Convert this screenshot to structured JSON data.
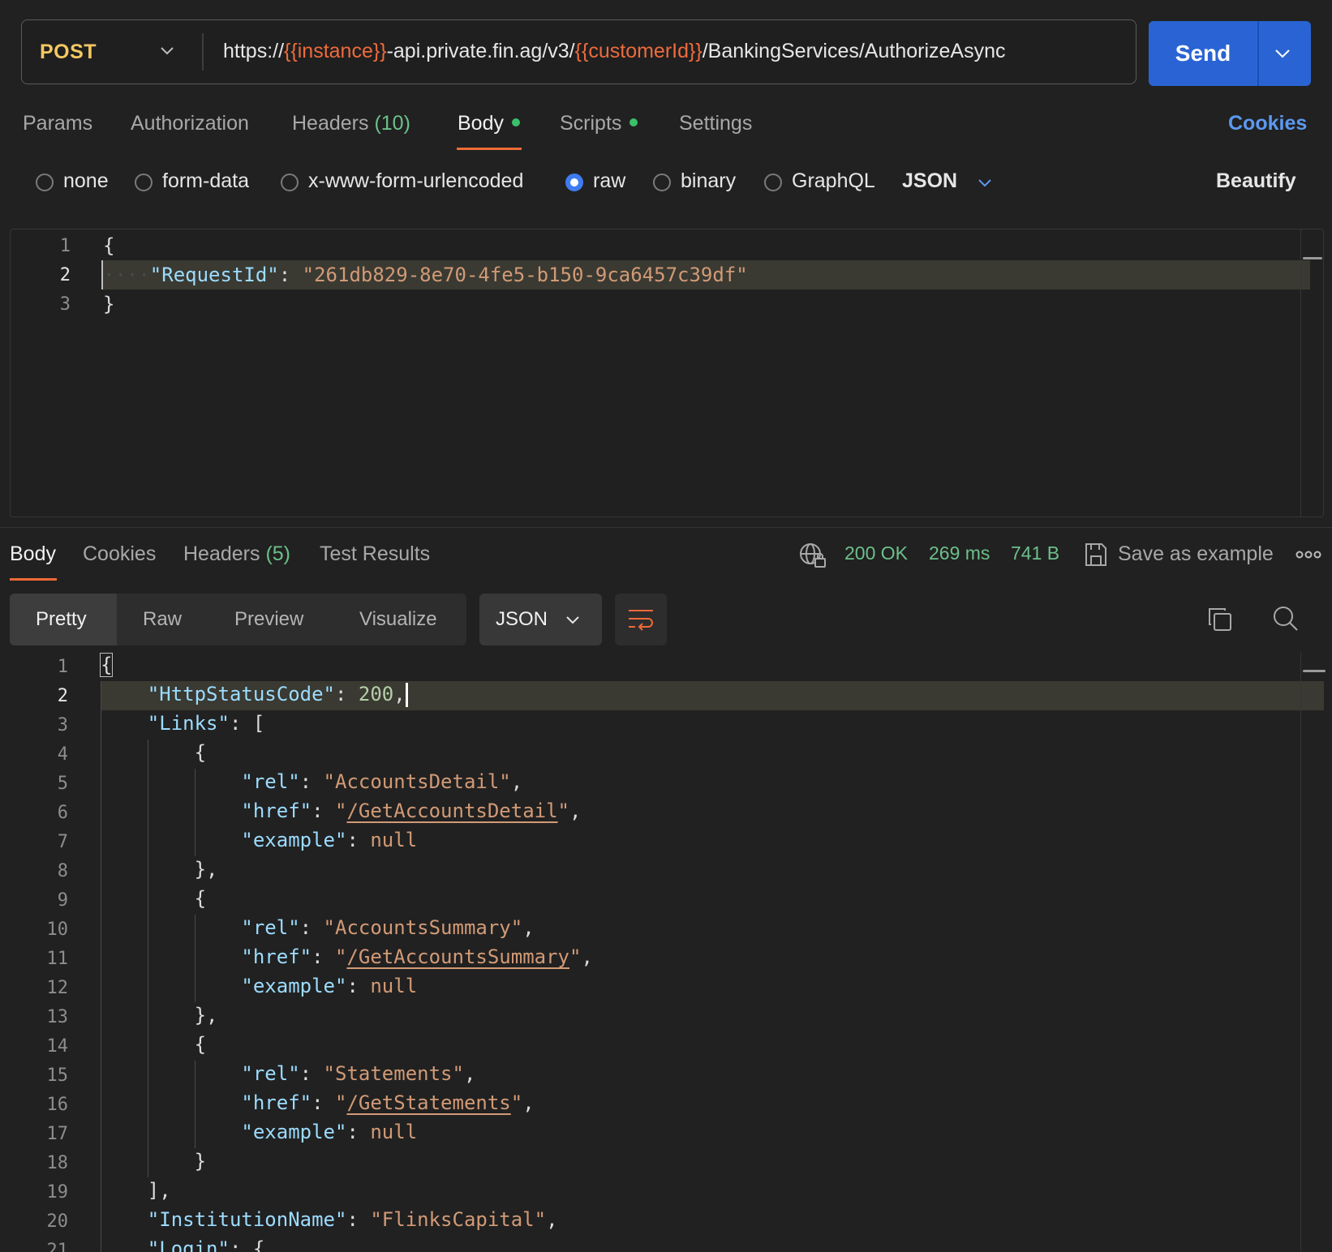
{
  "request": {
    "method": "POST",
    "url_parts": [
      {
        "text": "https://",
        "var": false
      },
      {
        "text": "{{instance}}",
        "var": true
      },
      {
        "text": "-api.private.fin.ag/v3/",
        "var": false
      },
      {
        "text": "{{customerId}}",
        "var": true
      },
      {
        "text": "/BankingServices/AuthorizeAsync",
        "var": false
      }
    ],
    "send_label": "Send"
  },
  "request_tabs": {
    "params": "Params",
    "authorization": "Authorization",
    "headers": "Headers",
    "headers_count": "(10)",
    "body": "Body",
    "scripts": "Scripts",
    "settings": "Settings",
    "cookies": "Cookies"
  },
  "body_types": {
    "none": "none",
    "form_data": "form-data",
    "urlencoded": "x-www-form-urlencoded",
    "raw": "raw",
    "binary": "binary",
    "graphql": "GraphQL",
    "format": "JSON",
    "beautify": "Beautify",
    "selected": "raw"
  },
  "request_body": {
    "line_numbers": [
      "1",
      "2",
      "3"
    ],
    "line1": "{",
    "key": "\"RequestId\"",
    "colon": ": ",
    "value": "\"261db829-8e70-4fe5-b150-9ca6457c39df\"",
    "line3": "}"
  },
  "response_tabs": {
    "body": "Body",
    "cookies": "Cookies",
    "headers": "Headers",
    "headers_count": "(5)",
    "test_results": "Test Results"
  },
  "response_status": {
    "code": "200 OK",
    "time": "269 ms",
    "size": "741 B",
    "save_example": "Save as example",
    "more": "ooo"
  },
  "view_modes": {
    "pretty": "Pretty",
    "raw": "Raw",
    "preview": "Preview",
    "visualize": "Visualize",
    "format": "JSON"
  },
  "response_body": {
    "line_numbers": [
      "1",
      "2",
      "3",
      "4",
      "5",
      "6",
      "7",
      "8",
      "9",
      "10",
      "11",
      "12",
      "13",
      "14",
      "15",
      "16",
      "17",
      "18",
      "19",
      "20",
      "21"
    ],
    "http_status_key": "\"HttpStatusCode\"",
    "http_status_value": "200",
    "links_key": "\"Links\"",
    "rel_key": "\"rel\"",
    "href_key": "\"href\"",
    "example_key": "\"example\"",
    "null": "null",
    "rel_1": "\"AccountsDetail\"",
    "href_1": "/GetAccountsDetail",
    "rel_2": "\"AccountsSummary\"",
    "href_2": "/GetAccountsSummary",
    "rel_3": "\"Statements\"",
    "href_3": "/GetStatements",
    "institution_key": "\"InstitutionName\"",
    "institution_value": "\"FlinksCapital\"",
    "login_key": "\"Login\""
  }
}
